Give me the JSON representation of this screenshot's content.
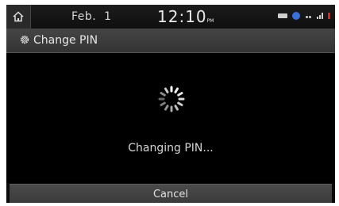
{
  "status_bar": {
    "date": "Feb.  1",
    "time": "12:10",
    "ampm": "PM",
    "home_icon": "home-icon",
    "icons": [
      "battery-icon",
      "bluetooth-icon",
      "connectivity-dots-icon",
      "signal-icon",
      "alert-icon"
    ]
  },
  "title_bar": {
    "icon": "gear-icon",
    "title": "Change PIN"
  },
  "main": {
    "spinner_icon": "loading-spinner-icon",
    "status_message": "Changing PIN..."
  },
  "footer": {
    "cancel_label": "Cancel"
  },
  "colors": {
    "background": "#000000",
    "title_bar": "#3c3c3c",
    "button": "#424242",
    "text": "#e0e0e0",
    "bluetooth": "#3a6fd8",
    "alert": "#e02020"
  }
}
